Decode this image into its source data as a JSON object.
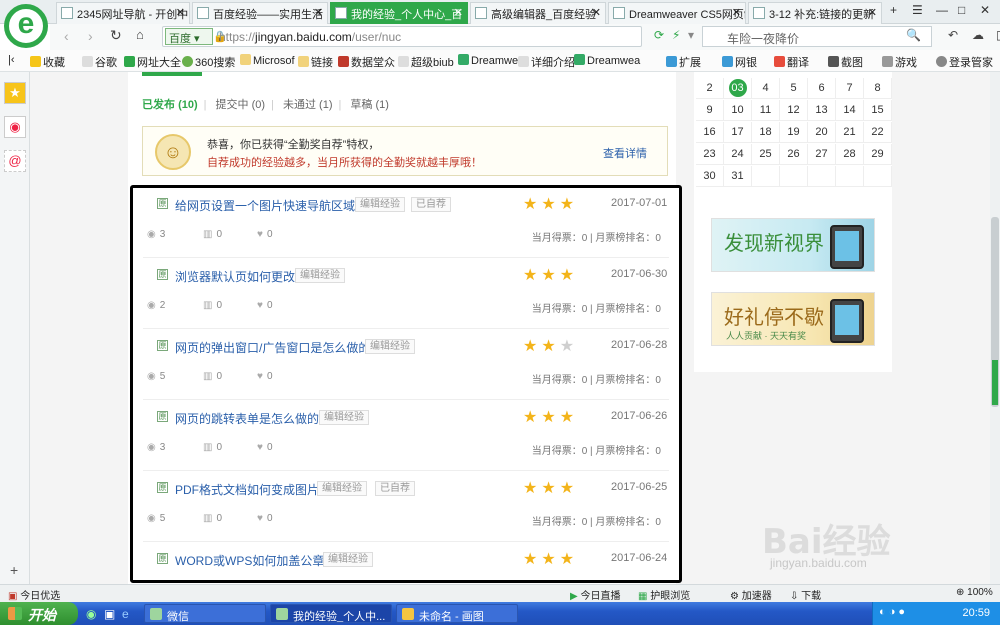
{
  "browser": {
    "tabs": [
      {
        "label": "2345网址导航 - 开创中",
        "active": false
      },
      {
        "label": "百度经验——实用生活",
        "active": false
      },
      {
        "label": "我的经验_个人中心_百",
        "active": true
      },
      {
        "label": "高级编辑器_百度经验",
        "active": false
      },
      {
        "label": "Dreamweaver CS5网页制",
        "active": false
      },
      {
        "label": "3-12 补充:链接的更新",
        "active": false
      }
    ],
    "window_controls": {
      "new_tab": "+",
      "menu": "☰",
      "minimize": "—",
      "maximize": "□",
      "close": "✕"
    },
    "engine": "百度",
    "url": {
      "protocol": "https://",
      "domain": "jingyan.baidu.com",
      "path": "/user/nuc"
    },
    "search_placeholder": "车险一夜降价",
    "bookmarks": [
      "收藏",
      "谷歌",
      "网址大全",
      "360搜索",
      "Microsof",
      "链接",
      "数据堂众",
      "超级biub",
      "Dreamwea",
      "详细介绍",
      "Dreamwea"
    ],
    "extensions": [
      "扩展",
      "网银",
      "翻译",
      "截图",
      "游戏",
      "登录管家"
    ]
  },
  "page": {
    "filter_tabs": [
      {
        "label": "已发布",
        "count": "(10)",
        "active": true
      },
      {
        "label": "提交中",
        "count": "(0)",
        "active": false
      },
      {
        "label": "未通过",
        "count": "(1)",
        "active": false
      },
      {
        "label": "草稿",
        "count": "(1)",
        "active": false
      }
    ],
    "notice": {
      "line1": "恭喜，你已获得“全勤奖自荐”特权，",
      "line2": "自荐成功的经验越多，当月所获得的全勤奖就越丰厚哦！",
      "link": "查看详情"
    },
    "items": [
      {
        "badge": "原",
        "title": "给网页设置一个图片快速导航区域",
        "tags": [
          "编辑经验",
          "已自荐"
        ],
        "stars": 3,
        "date": "2017-07-01",
        "views": "3",
        "votes": "0",
        "likes": "0",
        "rank": "当月得票：0 | 月票榜排名：0"
      },
      {
        "badge": "原",
        "title": "浏览器默认页如何更改",
        "tags": [
          "编辑经验"
        ],
        "stars": 3,
        "date": "2017-06-30",
        "views": "2",
        "votes": "0",
        "likes": "0",
        "rank": "当月得票：0 | 月票榜排名：0"
      },
      {
        "badge": "原",
        "title": "网页的弹出窗口/广告窗口是怎么做的",
        "tags": [
          "编辑经验"
        ],
        "stars": 2,
        "date": "2017-06-28",
        "views": "5",
        "votes": "0",
        "likes": "0",
        "rank": "当月得票：0 | 月票榜排名：0"
      },
      {
        "badge": "原",
        "title": "网页的跳转表单是怎么做的",
        "tags": [
          "编辑经验"
        ],
        "stars": 3,
        "date": "2017-06-26",
        "views": "3",
        "votes": "0",
        "likes": "0",
        "rank": "当月得票：0 | 月票榜排名：0"
      },
      {
        "badge": "原",
        "title": "PDF格式文档如何变成图片",
        "tags": [
          "编辑经验",
          "已自荐"
        ],
        "stars": 3,
        "date": "2017-06-25",
        "views": "5",
        "votes": "0",
        "likes": "0",
        "rank": "当月得票：0 | 月票榜排名：0"
      },
      {
        "badge": "原",
        "title": "WORD或WPS如何加盖公章",
        "tags": [
          "编辑经验"
        ],
        "stars": 3,
        "date": "2017-06-24",
        "views": "",
        "votes": "",
        "likes": "",
        "rank": ""
      }
    ],
    "calendar": {
      "today": "03",
      "weeks": [
        [
          "2",
          "03",
          "4",
          "5",
          "6",
          "7",
          "8"
        ],
        [
          "9",
          "10",
          "11",
          "12",
          "13",
          "14",
          "15"
        ],
        [
          "16",
          "17",
          "18",
          "19",
          "20",
          "21",
          "22"
        ],
        [
          "23",
          "24",
          "25",
          "26",
          "27",
          "28",
          "29"
        ],
        [
          "30",
          "31",
          "",
          "",
          "",
          "",
          ""
        ]
      ]
    },
    "banners": [
      {
        "title": "发现新视界",
        "subtitle": ""
      },
      {
        "title": "好礼停不歇",
        "subtitle": "人人贡献 · 天天有奖"
      }
    ],
    "watermark": "Bai经验",
    "watermark_url": "jingyan.baidu.com"
  },
  "statusbar": {
    "left": "今日优选",
    "items": [
      "今日直播",
      "护眼浏览",
      "加速器",
      "下载",
      "100%"
    ]
  },
  "taskbar": {
    "start": "开始",
    "tasks": [
      {
        "label": "微信",
        "active": false
      },
      {
        "label": "我的经验_个人中...",
        "active": true
      },
      {
        "label": "未命名 - 画图",
        "active": false
      }
    ],
    "clock": "20:59"
  },
  "colors": {
    "accent": "#2fa84a",
    "link": "#2a5faa",
    "star": "#f3b41a",
    "taskbar": "#2458c6"
  }
}
